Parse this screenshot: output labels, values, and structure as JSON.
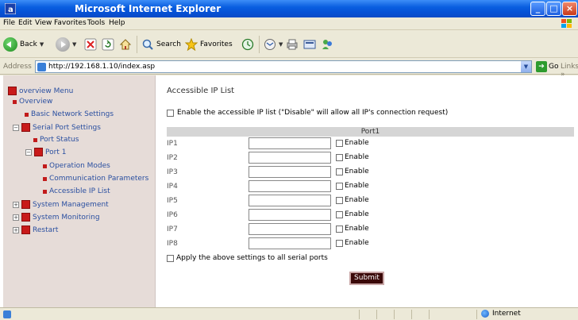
{
  "window": {
    "title": "Microsoft Internet Explorer"
  },
  "menubar": {
    "items": [
      "File",
      "Edit",
      "View",
      "Favorites",
      "Tools",
      "Help"
    ]
  },
  "toolbar": {
    "back_label": "Back",
    "search_label": "Search",
    "favorites_label": "Favorites"
  },
  "addressbar": {
    "label": "Address",
    "url": "http://192.168.1.10/index.asp",
    "go_label": "Go",
    "links_label": "Links"
  },
  "sidebar": {
    "items": [
      {
        "label": "overview Menu"
      },
      {
        "label": "Overview"
      },
      {
        "label": "Basic Network Settings"
      },
      {
        "label": "Serial Port Settings"
      },
      {
        "label": "Port Status"
      },
      {
        "label": "Port 1"
      },
      {
        "label": "Operation Modes"
      },
      {
        "label": "Communication Parameters"
      },
      {
        "label": "Accessible IP List"
      },
      {
        "label": "System Management"
      },
      {
        "label": "System Monitoring"
      },
      {
        "label": "Restart"
      }
    ]
  },
  "main": {
    "title": "Accessible IP List",
    "enable_all_label": "Enable the accessible IP list (\"Disable\" will allow all IP's connection request)",
    "port_header": "Port1",
    "rows": [
      {
        "label": "IP1",
        "value": "",
        "enable_label": "Enable"
      },
      {
        "label": "IP2",
        "value": "",
        "enable_label": "Enable"
      },
      {
        "label": "IP3",
        "value": "",
        "enable_label": "Enable"
      },
      {
        "label": "IP4",
        "value": "",
        "enable_label": "Enable"
      },
      {
        "label": "IP5",
        "value": "",
        "enable_label": "Enable"
      },
      {
        "label": "IP6",
        "value": "",
        "enable_label": "Enable"
      },
      {
        "label": "IP7",
        "value": "",
        "enable_label": "Enable"
      },
      {
        "label": "IP8",
        "value": "",
        "enable_label": "Enable"
      }
    ],
    "apply_all_label": "Apply the above settings to all serial ports",
    "submit_label": "Submit"
  },
  "statusbar": {
    "zone": "Internet"
  },
  "colors": {
    "titlebar": "#0a5fe0",
    "sidebar_bg": "#e6dcd8",
    "nav_link": "#2a4fa0",
    "bullet": "#c21b1b",
    "submit_bg": "#3b0909",
    "port_header_bg": "#d5d5d5"
  }
}
